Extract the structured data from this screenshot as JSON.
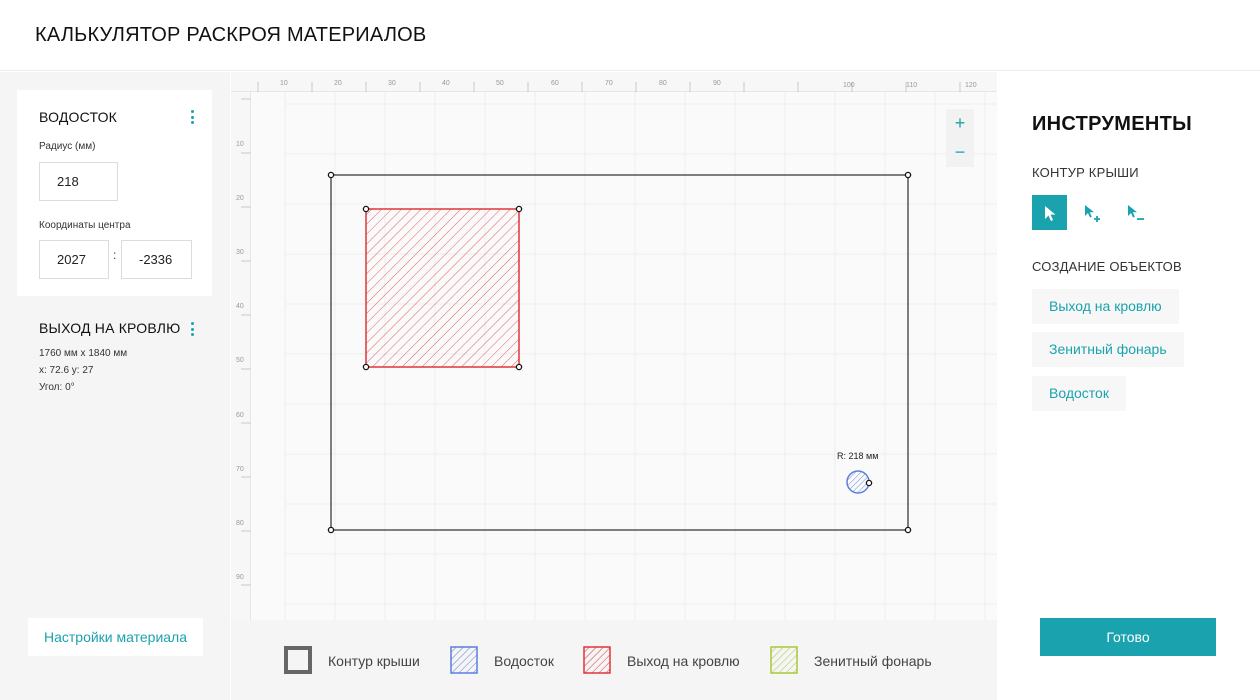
{
  "app": {
    "title": "КАЛЬКУЛЯТОР РАСКРОЯ МАТЕРИАЛОВ"
  },
  "left": {
    "gutter": {
      "title": "ВОДОСТОК",
      "radius_label": "Радиус (мм)",
      "radius_value": "218",
      "center_label": "Координаты центра",
      "center_x": "2027",
      "separator": ":",
      "center_y": "-2336"
    },
    "roof_exit": {
      "title": "ВЫХОД НА КРОВЛЮ",
      "size": "1760 мм х 1840 мм",
      "position": "x: 72.6 y: 27",
      "angle": "Угол: 0°"
    },
    "material_settings_label": "Настройки материала"
  },
  "canvas": {
    "ruler_top": [
      "10",
      "20",
      "30",
      "40",
      "50",
      "60",
      "70",
      "80",
      "90",
      "100",
      "110",
      "120"
    ],
    "ruler_left": [
      "10",
      "20",
      "30",
      "40",
      "50",
      "60",
      "70",
      "80",
      "90"
    ],
    "zoom_in": "+",
    "zoom_out": "−",
    "circle_label": "R: 218 мм"
  },
  "legend": [
    {
      "label": "Контур крыши",
      "color": "#666666"
    },
    {
      "label": "Водосток",
      "color": "#5b7fe0"
    },
    {
      "label": "Выход на кровлю",
      "color": "#e0353d"
    },
    {
      "label": "Зенитный фонарь",
      "color": "#a6c93a"
    }
  ],
  "right": {
    "title": "ИНСТРУМЕНТЫ",
    "contour_title": "КОНТУР КРЫШИ",
    "tools": [
      "select-pointer-icon",
      "add-point-icon",
      "remove-point-icon"
    ],
    "create_title": "СОЗДАНИЕ ОБЪЕКТОВ",
    "create_buttons": [
      "Выход на кровлю",
      "Зенитный фонарь",
      "Водосток"
    ],
    "done_label": "Готово"
  },
  "colors": {
    "accent": "#1aa3ae",
    "roof_exit": "#e0353d",
    "gutter": "#5b7fe0",
    "skylight": "#a6c93a",
    "contour": "#666666"
  }
}
